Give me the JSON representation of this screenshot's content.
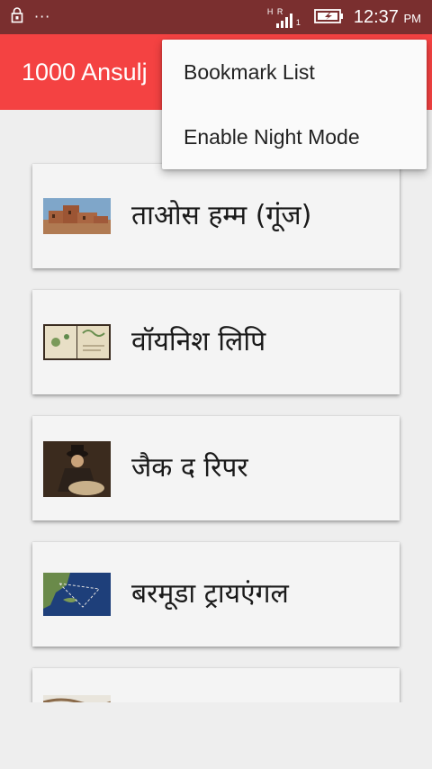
{
  "status_bar": {
    "time": "12:37",
    "ampm": "PM",
    "network_label": "H R",
    "sim_slot": "1",
    "more_dots": "···",
    "icons": [
      "lock-icon",
      "signal-icon",
      "battery-charging-icon"
    ]
  },
  "app_bar": {
    "title": "1000 Ansulj"
  },
  "menu": {
    "items": [
      {
        "label": "Bookmark List"
      },
      {
        "label": "Enable Night Mode"
      }
    ]
  },
  "list": {
    "items": [
      {
        "title": "ताओस हम्म (गूंज)",
        "thumb": "taos-pueblo-image"
      },
      {
        "title": "वॉयनिश लिपि",
        "thumb": "voynich-manuscript-image"
      },
      {
        "title": "जैक द रिपर",
        "thumb": "jack-the-ripper-image"
      },
      {
        "title": "बरमूडा ट्रायएंगल",
        "thumb": "bermuda-map-image"
      },
      {
        "title": "",
        "thumb": "partial-image"
      }
    ]
  },
  "colors": {
    "status_bar": "#7a2f2f",
    "app_bar": "#f44242",
    "background": "#eeeeee",
    "card": "#f4f4f4",
    "menu": "#fafafa"
  }
}
